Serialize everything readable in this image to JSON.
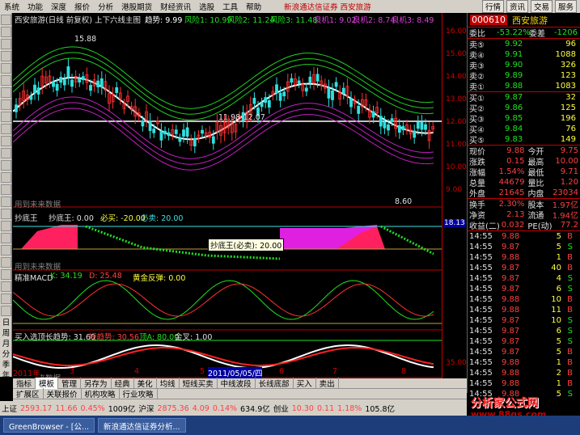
{
  "menu": {
    "items": [
      "系统",
      "功能",
      "深度",
      "报价",
      "分析",
      "港股期货",
      "财经资讯",
      "选股",
      "工具",
      "帮助"
    ],
    "title": "新浪通达信证券 西安旅游",
    "right_buttons": [
      "行情",
      "资讯",
      "交易",
      "服务"
    ]
  },
  "toolbar_vertical": [
    "日",
    "周",
    "月",
    "分",
    "季",
    "年"
  ],
  "main_chart": {
    "header": "西安旅游(日线 前复权) 上下六线主图",
    "trend_label": "趋势: 9.99",
    "wind1": "风险1: 10.99",
    "wind2": "风险2: 11.24",
    "wind3": "风险3: 11.48",
    "opp1": "良机1: 9.02",
    "opp2": "良机2: 8.74",
    "opp3": "良机3: 8.49",
    "peak_label": "15.88",
    "mid_label": "11.98-12.07",
    "low_label": "8.60",
    "future_label": "用到未来数据"
  },
  "sub1": {
    "title": "抄底王",
    "v1": "抄底王: 0.00",
    "v2": "必买: -20.00",
    "v3": "必卖: 20.00",
    "tooltip": "抄底王(必卖): 20.00",
    "future_label": "用到未来数据",
    "axis_val": "18.13"
  },
  "sub2": {
    "title": "精准MACD",
    "k": "K: 34.19",
    "d": "D: 25.48",
    "gold": "黄金反弹: 0.00"
  },
  "sub3": {
    "title": "买入选顶",
    "long": "长趋势: 31.60",
    "short": "短趋势: 30.56",
    "top": "顶A: 80.00",
    "cross": "金叉: 1.00",
    "future_label": "用到未来数据",
    "axis_val": "35.00"
  },
  "date_axis": {
    "year": "2011年",
    "months": [
      "3",
      "4",
      "5",
      "6",
      "7",
      "8"
    ],
    "cursor": "2011/05/05/四",
    "right": "日线"
  },
  "price_axis": [
    "16.00",
    "15.00",
    "14.00",
    "13.00",
    "12.00",
    "11.00",
    "10.00",
    "9.00"
  ],
  "quote": {
    "code": "000610",
    "name": "西安旅游",
    "weibi_label": "委比",
    "weibi": "-53.22%",
    "weicha_label": "委差",
    "weicha": "-1206",
    "asks": [
      {
        "label": "卖⑤",
        "price": "9.92",
        "vol": "96"
      },
      {
        "label": "卖④",
        "price": "9.91",
        "vol": "1088"
      },
      {
        "label": "卖③",
        "price": "9.90",
        "vol": "326"
      },
      {
        "label": "卖②",
        "price": "9.89",
        "vol": "123"
      },
      {
        "label": "卖①",
        "price": "9.88",
        "vol": "1083"
      }
    ],
    "bids": [
      {
        "label": "买①",
        "price": "9.87",
        "vol": "32"
      },
      {
        "label": "买②",
        "price": "9.86",
        "vol": "125"
      },
      {
        "label": "买③",
        "price": "9.85",
        "vol": "196"
      },
      {
        "label": "买④",
        "price": "9.84",
        "vol": "76"
      },
      {
        "label": "买⑤",
        "price": "9.83",
        "vol": "149"
      }
    ],
    "stats": [
      {
        "l1": "现价",
        "v1": "9.88",
        "l2": "今开",
        "v2": "9.75"
      },
      {
        "l1": "涨跌",
        "v1": "0.15",
        "l2": "最高",
        "v2": "10.00"
      },
      {
        "l1": "涨幅",
        "v1": "1.54%",
        "l2": "最低",
        "v2": "9.71"
      },
      {
        "l1": "总量",
        "v1": "44679",
        "l2": "量比",
        "v2": "1.20"
      },
      {
        "l1": "外盘",
        "v1": "21645",
        "l2": "内盘",
        "v2": "23034"
      }
    ],
    "stats2": [
      {
        "l1": "换手",
        "v1": "2.30%",
        "l2": "股本",
        "v2": "1.97亿"
      },
      {
        "l1": "净资",
        "v1": "2.13",
        "l2": "流通",
        "v2": "1.94亿"
      },
      {
        "l1": "收益(二)",
        "v1": "0.032",
        "l2": "PE(动)",
        "v2": "77.2"
      }
    ],
    "ticks": [
      {
        "t": "14:55",
        "p": "9.88",
        "v": "5",
        "d": "B"
      },
      {
        "t": "14:55",
        "p": "9.87",
        "v": "5",
        "d": "S"
      },
      {
        "t": "14:55",
        "p": "9.88",
        "v": "1",
        "d": "B"
      },
      {
        "t": "14:55",
        "p": "9.87",
        "v": "40",
        "d": "B"
      },
      {
        "t": "14:55",
        "p": "9.87",
        "v": "4",
        "d": "S"
      },
      {
        "t": "14:55",
        "p": "9.87",
        "v": "6",
        "d": "S"
      },
      {
        "t": "14:55",
        "p": "9.88",
        "v": "10",
        "d": "B"
      },
      {
        "t": "14:55",
        "p": "9.88",
        "v": "11",
        "d": "B"
      },
      {
        "t": "14:55",
        "p": "9.87",
        "v": "10",
        "d": "S"
      },
      {
        "t": "14:55",
        "p": "9.87",
        "v": "6",
        "d": "S"
      },
      {
        "t": "14:55",
        "p": "9.87",
        "v": "5",
        "d": "S"
      },
      {
        "t": "14:55",
        "p": "9.87",
        "v": "5",
        "d": "B"
      },
      {
        "t": "14:55",
        "p": "9.88",
        "v": "1",
        "d": "B"
      },
      {
        "t": "14:55",
        "p": "9.88",
        "v": "2",
        "d": "B"
      },
      {
        "t": "14:55",
        "p": "9.88",
        "v": "1",
        "d": "B"
      },
      {
        "t": "14:55",
        "p": "9.88",
        "v": "5",
        "d": "S"
      }
    ]
  },
  "tabs": {
    "row1": [
      "指标",
      "模板",
      "管理",
      "另存为",
      "经典",
      "美化",
      "均线",
      "短线买卖",
      "中线波段",
      "长线底部",
      "买入",
      "卖出"
    ],
    "row2": [
      "扩展区",
      "关联报价",
      "机构攻略",
      "行业攻略"
    ]
  },
  "status": {
    "sh_label": "上证",
    "sh": "2593.17",
    "sh_chg": "11.66",
    "sh_pct": "0.45%",
    "sh_amt": "1009亿",
    "hs_label": "沪深",
    "hs": "2875.36",
    "hs_chg": "4.09",
    "hs_pct": "0.14%",
    "hs_amt": "634.9亿",
    "cy_label": "创业",
    "cy": "10.30",
    "cy_chg": "0.11",
    "cy_pct": "1.18%",
    "cy_amt": "105.8亿"
  },
  "taskbar": {
    "items": [
      "GreenBrowser - [公...",
      "新浪通达信证券分析..."
    ]
  },
  "watermark": {
    "line1": "分析家公式网",
    "line2": "www.88gs.com"
  }
}
